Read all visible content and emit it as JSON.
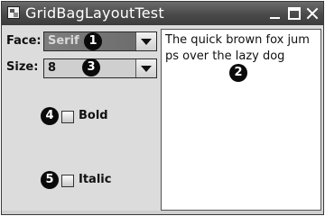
{
  "window": {
    "title": "GridBagLayoutTest"
  },
  "form": {
    "face_label": "Face:",
    "face_value": "Serif",
    "size_label": "Size:",
    "size_value": "8",
    "bold_label": "Bold",
    "italic_label": "Italic"
  },
  "textarea": {
    "text": "The quick brown fox jum\nps over the lazy dog"
  },
  "callouts": [
    "1",
    "2",
    "3",
    "4",
    "5"
  ],
  "icons": {
    "app": "window-app-icon",
    "minimize": "minimize-icon",
    "maximize": "maximize-icon",
    "close": "close-icon",
    "dropdown": "chevron-down-icon"
  }
}
